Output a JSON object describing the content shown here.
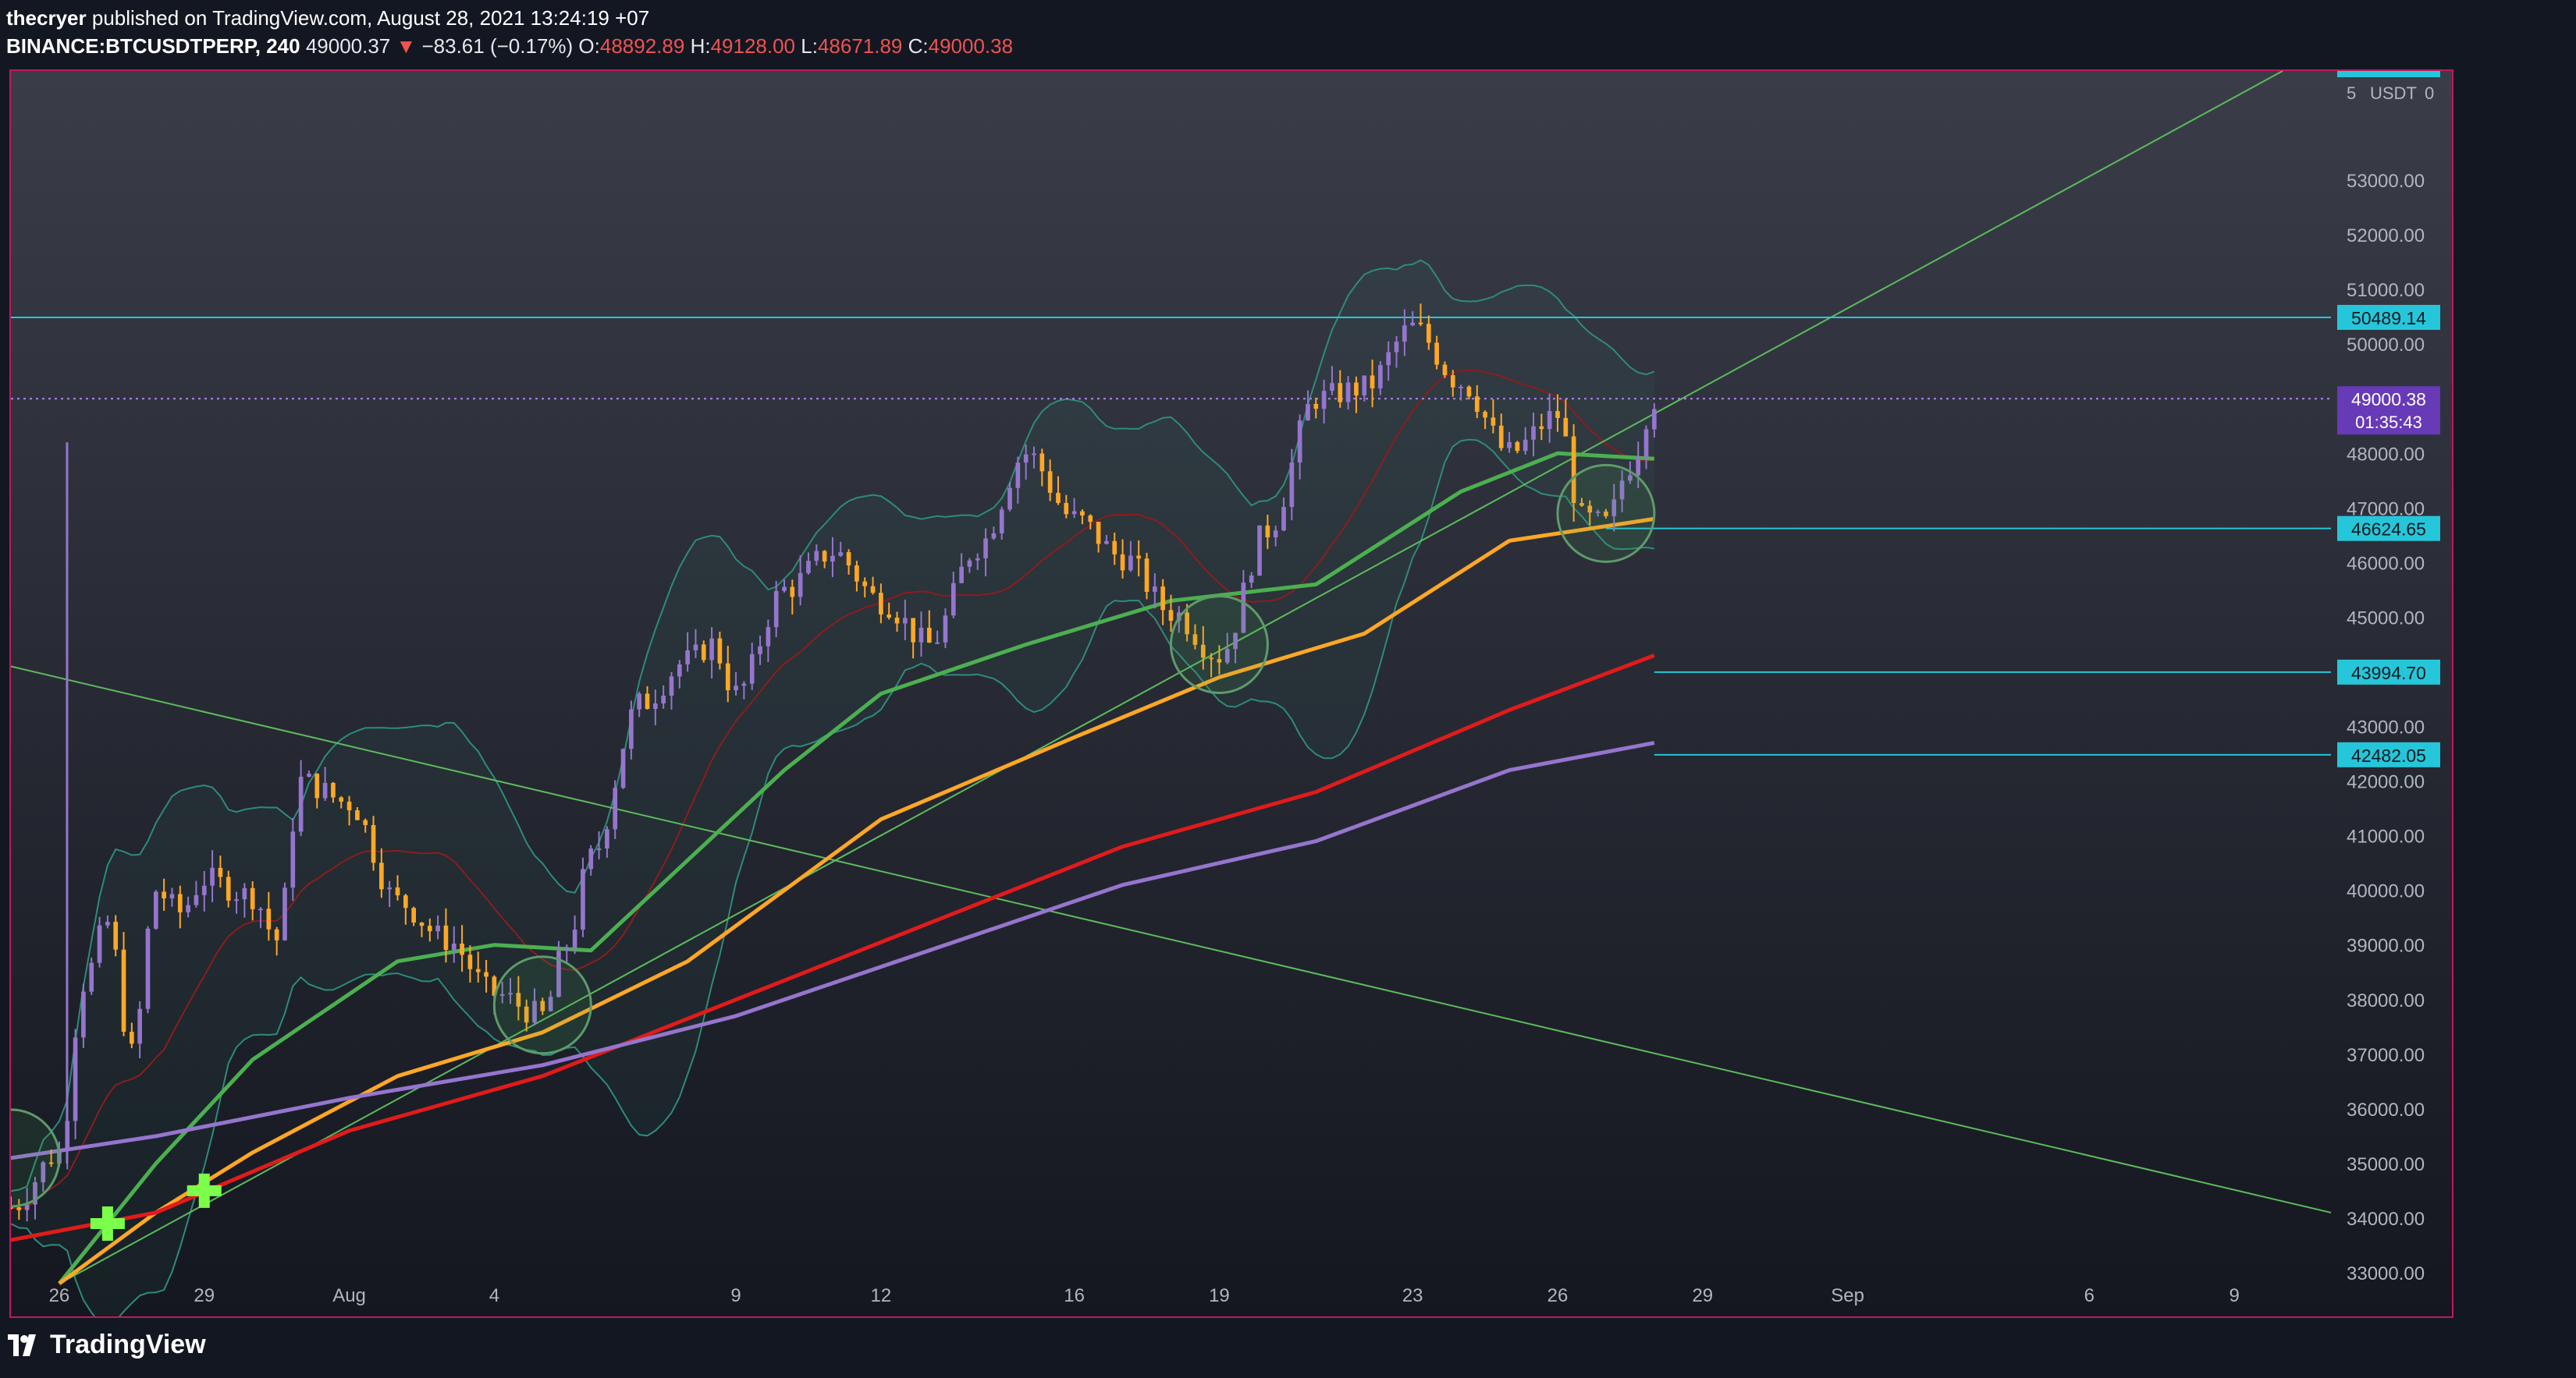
{
  "header": {
    "author": "thecryer",
    "published_text": "published on TradingView.com, August 28, 2021 13:24:19 +07",
    "symbol": "BINANCE:BTCUSDTPERP, 240",
    "last_price": "49000.37",
    "change_arrow": "▼",
    "change": "−83.61 (−0.17%)",
    "o_label": "O:",
    "o_value": "48892.89",
    "h_label": "H:",
    "h_value": "49128.00",
    "l_label": "L:",
    "l_value": "48671.89",
    "c_label": "C:",
    "c_value": "49000.38"
  },
  "footer": {
    "logo_text": "TradingView"
  },
  "colors": {
    "background_top": "#3a3d48",
    "background_bottom": "#14171f",
    "up_candle": "#9575cd",
    "down_candle": "#ffa726",
    "ema_fast": "#4caf50",
    "ema_mid": "#ffa726",
    "ema_slow": "#e01b1b",
    "ema_slowest": "#9575cd",
    "bollinger": "#2e8b78",
    "level": "#26c6da",
    "trend": "#5dbb5d",
    "current_price": "#673ab7",
    "frame": "#c2185b"
  },
  "chart_data": {
    "type": "candlestick",
    "title": "BINANCE:BTCUSDTPERP, 240",
    "currency_label": "USDT",
    "ylim": [
      32800,
      55000
    ],
    "y_ticks": [
      "53000.00",
      "52000.00",
      "51000.00",
      "50000.00",
      "49000.00",
      "48000.00",
      "47000.00",
      "46000.00",
      "45000.00",
      "44000.00",
      "43000.00",
      "42000.00",
      "41000.00",
      "40000.00",
      "39000.00",
      "38000.00",
      "37000.00",
      "36000.00",
      "35000.00",
      "34000.00",
      "33000.00"
    ],
    "x_ticks": [
      "26",
      "29",
      "Aug",
      "4",
      "9",
      "12",
      "16",
      "19",
      "23",
      "26",
      "29",
      "Sep",
      "6",
      "9"
    ],
    "x_tick_dates": [
      "2021-07-26",
      "2021-07-29",
      "2021-08-01",
      "2021-08-04",
      "2021-08-09",
      "2021-08-12",
      "2021-08-16",
      "2021-08-19",
      "2021-08-23",
      "2021-08-26",
      "2021-08-29",
      "2021-09-01",
      "2021-09-06",
      "2021-09-09"
    ],
    "xlim": [
      "2021-07-25",
      "2021-09-11"
    ],
    "price_series": [
      [
        "2021-07-25",
        34200
      ],
      [
        "2021-07-26",
        35200
      ],
      [
        "2021-07-26",
        38300
      ],
      [
        "2021-07-27",
        39400
      ],
      [
        "2021-07-27",
        37000
      ],
      [
        "2021-07-28",
        40000
      ],
      [
        "2021-07-28",
        39600
      ],
      [
        "2021-07-29",
        40200
      ],
      [
        "2021-07-30",
        39900
      ],
      [
        "2021-07-30",
        39100
      ],
      [
        "2021-07-31",
        42000
      ],
      [
        "2021-08-01",
        41600
      ],
      [
        "2021-08-02",
        39800
      ],
      [
        "2021-08-03",
        39100
      ],
      [
        "2021-08-04",
        38100
      ],
      [
        "2021-08-05",
        37700
      ],
      [
        "2021-08-05",
        39000
      ],
      [
        "2021-08-06",
        40600
      ],
      [
        "2021-08-07",
        43400
      ],
      [
        "2021-08-08",
        44200
      ],
      [
        "2021-08-08",
        44500
      ],
      [
        "2021-08-09",
        43600
      ],
      [
        "2021-08-10",
        45500
      ],
      [
        "2021-08-11",
        46200
      ],
      [
        "2021-08-12",
        45300
      ],
      [
        "2021-08-13",
        44500
      ],
      [
        "2021-08-14",
        46300
      ],
      [
        "2021-08-15",
        48000
      ],
      [
        "2021-08-16",
        46800
      ],
      [
        "2021-08-17",
        46100
      ],
      [
        "2021-08-18",
        45100
      ],
      [
        "2021-08-19",
        44300
      ],
      [
        "2021-08-20",
        46600
      ],
      [
        "2021-08-21",
        49000
      ],
      [
        "2021-08-22",
        49200
      ],
      [
        "2021-08-23",
        50300
      ],
      [
        "2021-08-24",
        49300
      ],
      [
        "2021-08-25",
        48000
      ],
      [
        "2021-08-26",
        48700
      ],
      [
        "2021-08-26",
        46800
      ],
      [
        "2021-08-27",
        46700
      ],
      [
        "2021-08-27",
        47800
      ],
      [
        "2021-08-28",
        49000
      ]
    ],
    "wick_high": [
      [
        "2021-07-26",
        48200
      ]
    ],
    "moving_averages": [
      {
        "key": "ema_fast",
        "points": [
          [
            "2021-07-26",
            32800
          ],
          [
            "2021-07-28",
            35000
          ],
          [
            "2021-07-30",
            36900
          ],
          [
            "2021-08-02",
            38700
          ],
          [
            "2021-08-04",
            39000
          ],
          [
            "2021-08-06",
            38900
          ],
          [
            "2021-08-10",
            42200
          ],
          [
            "2021-08-12",
            43600
          ],
          [
            "2021-08-15",
            44500
          ],
          [
            "2021-08-18",
            45300
          ],
          [
            "2021-08-21",
            45600
          ],
          [
            "2021-08-24",
            47300
          ],
          [
            "2021-08-26",
            48000
          ],
          [
            "2021-08-28",
            47900
          ]
        ]
      },
      {
        "key": "ema_mid",
        "points": [
          [
            "2021-07-26",
            32800
          ],
          [
            "2021-07-28",
            34100
          ],
          [
            "2021-07-30",
            35200
          ],
          [
            "2021-08-02",
            36600
          ],
          [
            "2021-08-05",
            37400
          ],
          [
            "2021-08-08",
            38700
          ],
          [
            "2021-08-12",
            41300
          ],
          [
            "2021-08-16",
            42800
          ],
          [
            "2021-08-19",
            43900
          ],
          [
            "2021-08-22",
            44700
          ],
          [
            "2021-08-25",
            46400
          ],
          [
            "2021-08-28",
            46800
          ]
        ]
      },
      {
        "key": "ema_slow",
        "points": [
          [
            "2021-07-25",
            33600
          ],
          [
            "2021-07-28",
            34100
          ],
          [
            "2021-08-01",
            35600
          ],
          [
            "2021-08-05",
            36600
          ],
          [
            "2021-08-09",
            38000
          ],
          [
            "2021-08-13",
            39400
          ],
          [
            "2021-08-17",
            40800
          ],
          [
            "2021-08-21",
            41800
          ],
          [
            "2021-08-25",
            43300
          ],
          [
            "2021-08-28",
            44300
          ]
        ]
      },
      {
        "key": "ema_slowest",
        "points": [
          [
            "2021-07-25",
            35100
          ],
          [
            "2021-07-28",
            35500
          ],
          [
            "2021-08-01",
            36200
          ],
          [
            "2021-08-05",
            36800
          ],
          [
            "2021-08-09",
            37700
          ],
          [
            "2021-08-13",
            38900
          ],
          [
            "2021-08-17",
            40100
          ],
          [
            "2021-08-21",
            40900
          ],
          [
            "2021-08-25",
            42200
          ],
          [
            "2021-08-28",
            42700
          ]
        ]
      }
    ],
    "horizontal_levels": [
      {
        "price": 50489.14,
        "label": "50489.14",
        "from": "2021-07-25"
      },
      {
        "price": 46624.65,
        "label": "46624.65",
        "from": "2021-08-27"
      },
      {
        "price": 43994.7,
        "label": "43994.70",
        "from": "2021-08-28"
      },
      {
        "price": 42482.05,
        "label": "42482.05",
        "from": "2021-08-28"
      }
    ],
    "current_price": {
      "price": 49000.38,
      "label": "49000.38",
      "countdown": "01:35:43"
    },
    "trend_lines": [
      {
        "from": [
          "2021-07-25",
          44100
        ],
        "to": [
          "2021-09-11",
          34100
        ]
      },
      {
        "from": [
          "2021-07-26",
          32800
        ],
        "to": [
          "2021-09-10",
          55000
        ]
      }
    ],
    "highlight_circles": [
      {
        "date": "2021-07-25",
        "price": 35100
      },
      {
        "date": "2021-08-05",
        "price": 37900
      },
      {
        "date": "2021-08-19",
        "price": 44500
      },
      {
        "date": "2021-08-27",
        "price": 46900
      }
    ],
    "cross_markers": [
      {
        "date": "2021-07-27",
        "price": 33900
      },
      {
        "date": "2021-07-29",
        "price": 34500
      }
    ]
  }
}
